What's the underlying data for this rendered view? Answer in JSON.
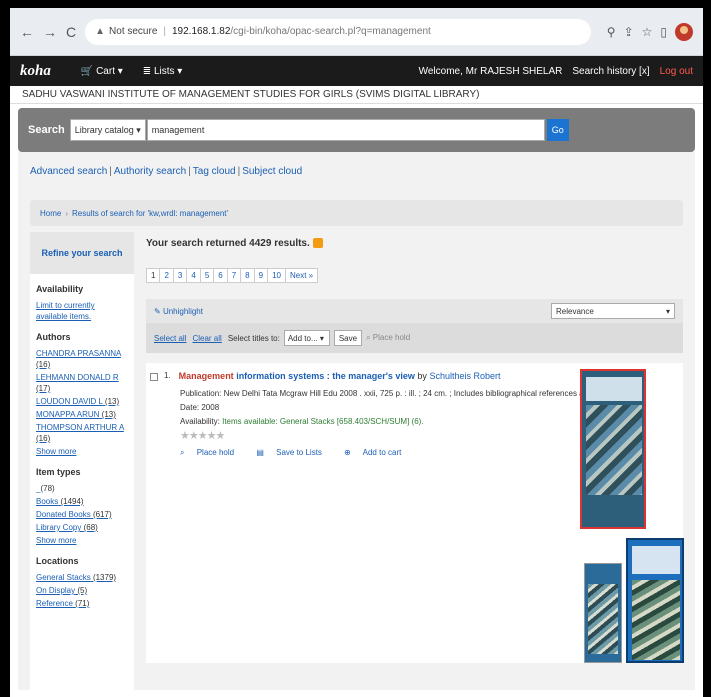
{
  "browser": {
    "security": "Not secure",
    "host": "192.168.1.82",
    "path": "/cgi-bin/koha/opac-search.pl?q=management"
  },
  "koha_bar": {
    "logo": "koha",
    "cart": "Cart",
    "lists": "Lists",
    "welcome": "Welcome, Mr RAJESH SHELAR",
    "history": "Search history [x]",
    "logout": "Log out"
  },
  "library_name": "SADHU VASWANI INSTITUTE OF MANAGEMENT STUDIES FOR GIRLS (SVIMS DIGITAL LIBRARY)",
  "search": {
    "label": "Search",
    "scope": "Library catalog",
    "query": "management",
    "go": "Go"
  },
  "search_links": [
    "Advanced search",
    "Authority search",
    "Tag cloud",
    "Subject cloud"
  ],
  "breadcrumb": {
    "home": "Home",
    "current": "Results of search for 'kw,wrdl: management'"
  },
  "sidebar": {
    "refine": "Refine your search",
    "availability_h": "Availability",
    "availability_link": "Limit to currently available items.",
    "authors_h": "Authors",
    "authors": [
      {
        "name": "CHANDRA PRASANNA",
        "count": "(16)"
      },
      {
        "name": "LEHMANN DONALD R",
        "count": "(17)"
      },
      {
        "name": "LOUDON DAVID L",
        "count": "(13)"
      },
      {
        "name": "MONAPPA ARUN",
        "count": "(13)"
      },
      {
        "name": "THOMPSON ARTHUR A",
        "count": "(16)"
      }
    ],
    "show_more": "Show more",
    "itemtypes_h": "Item types",
    "itemtypes": [
      {
        "name": "_",
        "count": "(78)"
      },
      {
        "name": "Books",
        "count": "(1494)"
      },
      {
        "name": "Donated Books",
        "count": "(617)"
      },
      {
        "name": "Library Copy",
        "count": "(68)"
      }
    ],
    "locations_h": "Locations",
    "locations": [
      {
        "name": "General Stacks",
        "count": "(1379)"
      },
      {
        "name": "On Display",
        "count": "(5)"
      },
      {
        "name": "Reference",
        "count": "(71)"
      }
    ]
  },
  "results": {
    "count_text": "Your search returned 4429 results.",
    "pages": [
      "1",
      "2",
      "3",
      "4",
      "5",
      "6",
      "7",
      "8",
      "9",
      "10",
      "Next »"
    ],
    "unhighlight": "Unhighlight",
    "sort": "Relevance",
    "select_all": "Select all",
    "clear_all": "Clear all",
    "select_titles": "Select titles to:",
    "add_to": "Add to...",
    "save": "Save",
    "place_hold": "Place hold"
  },
  "record": {
    "num": "1.",
    "title_hl": "Management",
    "title_rest": " information systems : the manager's view",
    "by": "by",
    "author": "Schultheis Robert",
    "publication_label": "Publication:",
    "publication": "New Delhi Tata Mcgraw Hill Edu 2008 . xxii, 725 p. : ill. ; 24 cm. ; Includes bibliographical references and index.",
    "date_label": "Date:",
    "date": "2008",
    "availability_label": "Availability:",
    "availability": "Items available: General Stacks [658.403/SCH/SUM] (6).",
    "stars": "★★★★★",
    "actions": [
      "Place hold",
      "Save to Lists",
      "Add to cart"
    ]
  }
}
